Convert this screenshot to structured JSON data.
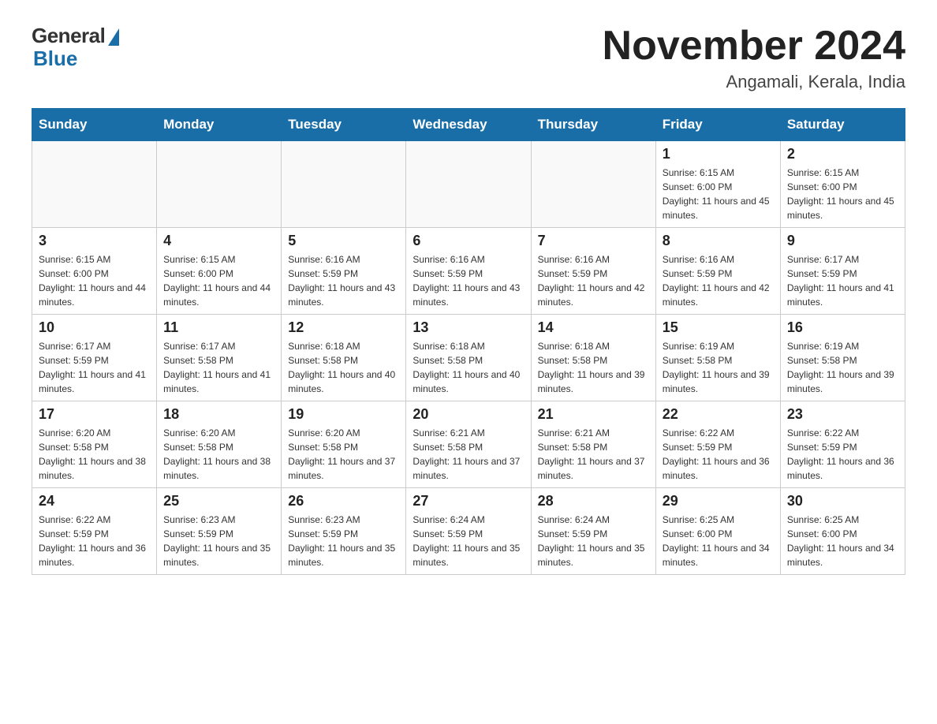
{
  "header": {
    "logo_general": "General",
    "logo_blue": "Blue",
    "month_title": "November 2024",
    "location": "Angamali, Kerala, India"
  },
  "weekdays": [
    "Sunday",
    "Monday",
    "Tuesday",
    "Wednesday",
    "Thursday",
    "Friday",
    "Saturday"
  ],
  "weeks": [
    [
      {
        "day": "",
        "info": ""
      },
      {
        "day": "",
        "info": ""
      },
      {
        "day": "",
        "info": ""
      },
      {
        "day": "",
        "info": ""
      },
      {
        "day": "",
        "info": ""
      },
      {
        "day": "1",
        "info": "Sunrise: 6:15 AM\nSunset: 6:00 PM\nDaylight: 11 hours and 45 minutes."
      },
      {
        "day": "2",
        "info": "Sunrise: 6:15 AM\nSunset: 6:00 PM\nDaylight: 11 hours and 45 minutes."
      }
    ],
    [
      {
        "day": "3",
        "info": "Sunrise: 6:15 AM\nSunset: 6:00 PM\nDaylight: 11 hours and 44 minutes."
      },
      {
        "day": "4",
        "info": "Sunrise: 6:15 AM\nSunset: 6:00 PM\nDaylight: 11 hours and 44 minutes."
      },
      {
        "day": "5",
        "info": "Sunrise: 6:16 AM\nSunset: 5:59 PM\nDaylight: 11 hours and 43 minutes."
      },
      {
        "day": "6",
        "info": "Sunrise: 6:16 AM\nSunset: 5:59 PM\nDaylight: 11 hours and 43 minutes."
      },
      {
        "day": "7",
        "info": "Sunrise: 6:16 AM\nSunset: 5:59 PM\nDaylight: 11 hours and 42 minutes."
      },
      {
        "day": "8",
        "info": "Sunrise: 6:16 AM\nSunset: 5:59 PM\nDaylight: 11 hours and 42 minutes."
      },
      {
        "day": "9",
        "info": "Sunrise: 6:17 AM\nSunset: 5:59 PM\nDaylight: 11 hours and 41 minutes."
      }
    ],
    [
      {
        "day": "10",
        "info": "Sunrise: 6:17 AM\nSunset: 5:59 PM\nDaylight: 11 hours and 41 minutes."
      },
      {
        "day": "11",
        "info": "Sunrise: 6:17 AM\nSunset: 5:58 PM\nDaylight: 11 hours and 41 minutes."
      },
      {
        "day": "12",
        "info": "Sunrise: 6:18 AM\nSunset: 5:58 PM\nDaylight: 11 hours and 40 minutes."
      },
      {
        "day": "13",
        "info": "Sunrise: 6:18 AM\nSunset: 5:58 PM\nDaylight: 11 hours and 40 minutes."
      },
      {
        "day": "14",
        "info": "Sunrise: 6:18 AM\nSunset: 5:58 PM\nDaylight: 11 hours and 39 minutes."
      },
      {
        "day": "15",
        "info": "Sunrise: 6:19 AM\nSunset: 5:58 PM\nDaylight: 11 hours and 39 minutes."
      },
      {
        "day": "16",
        "info": "Sunrise: 6:19 AM\nSunset: 5:58 PM\nDaylight: 11 hours and 39 minutes."
      }
    ],
    [
      {
        "day": "17",
        "info": "Sunrise: 6:20 AM\nSunset: 5:58 PM\nDaylight: 11 hours and 38 minutes."
      },
      {
        "day": "18",
        "info": "Sunrise: 6:20 AM\nSunset: 5:58 PM\nDaylight: 11 hours and 38 minutes."
      },
      {
        "day": "19",
        "info": "Sunrise: 6:20 AM\nSunset: 5:58 PM\nDaylight: 11 hours and 37 minutes."
      },
      {
        "day": "20",
        "info": "Sunrise: 6:21 AM\nSunset: 5:58 PM\nDaylight: 11 hours and 37 minutes."
      },
      {
        "day": "21",
        "info": "Sunrise: 6:21 AM\nSunset: 5:58 PM\nDaylight: 11 hours and 37 minutes."
      },
      {
        "day": "22",
        "info": "Sunrise: 6:22 AM\nSunset: 5:59 PM\nDaylight: 11 hours and 36 minutes."
      },
      {
        "day": "23",
        "info": "Sunrise: 6:22 AM\nSunset: 5:59 PM\nDaylight: 11 hours and 36 minutes."
      }
    ],
    [
      {
        "day": "24",
        "info": "Sunrise: 6:22 AM\nSunset: 5:59 PM\nDaylight: 11 hours and 36 minutes."
      },
      {
        "day": "25",
        "info": "Sunrise: 6:23 AM\nSunset: 5:59 PM\nDaylight: 11 hours and 35 minutes."
      },
      {
        "day": "26",
        "info": "Sunrise: 6:23 AM\nSunset: 5:59 PM\nDaylight: 11 hours and 35 minutes."
      },
      {
        "day": "27",
        "info": "Sunrise: 6:24 AM\nSunset: 5:59 PM\nDaylight: 11 hours and 35 minutes."
      },
      {
        "day": "28",
        "info": "Sunrise: 6:24 AM\nSunset: 5:59 PM\nDaylight: 11 hours and 35 minutes."
      },
      {
        "day": "29",
        "info": "Sunrise: 6:25 AM\nSunset: 6:00 PM\nDaylight: 11 hours and 34 minutes."
      },
      {
        "day": "30",
        "info": "Sunrise: 6:25 AM\nSunset: 6:00 PM\nDaylight: 11 hours and 34 minutes."
      }
    ]
  ]
}
